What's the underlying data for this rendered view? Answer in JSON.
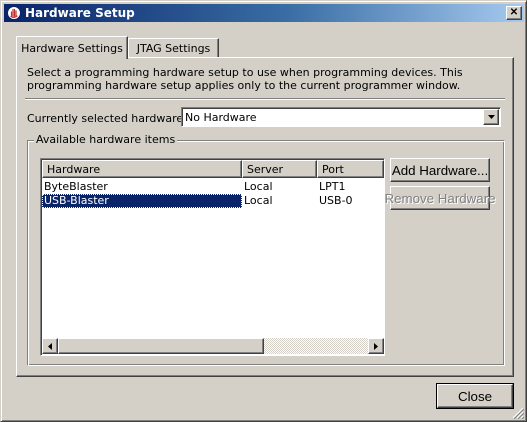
{
  "window": {
    "title": "Hardware Setup",
    "close_glyph": "✕"
  },
  "tabs": [
    {
      "label": "Hardware Settings",
      "active": true
    },
    {
      "label": "JTAG Settings",
      "active": false
    }
  ],
  "hardware_settings": {
    "description": "Select a programming hardware setup to use when programming devices. This programming hardware setup applies only to the current programmer window.",
    "currently_selected_label": "Currently selected hardware:",
    "currently_selected_value": "No Hardware",
    "group_label": "Available hardware items",
    "columns": [
      "Hardware",
      "Server",
      "Port"
    ],
    "rows": [
      {
        "hardware": "ByteBlaster",
        "server": "Local",
        "port": "LPT1",
        "selected": false
      },
      {
        "hardware": "USB-Blaster",
        "server": "Local",
        "port": "USB-0",
        "selected": true
      }
    ],
    "add_button": "Add Hardware...",
    "remove_button": "Remove Hardware",
    "remove_enabled": false
  },
  "footer": {
    "close_button": "Close"
  },
  "colors": {
    "face": "#d4d0c8",
    "titlebar_start": "#0a246a",
    "titlebar_end": "#a6caf0",
    "selection": "#0a246a",
    "disabled_text": "#808080"
  },
  "icons": [
    "hand-app-icon",
    "close-icon",
    "dropdown-arrow-icon",
    "scroll-left-arrow-icon",
    "scroll-right-arrow-icon",
    "resize-grip-icon"
  ]
}
